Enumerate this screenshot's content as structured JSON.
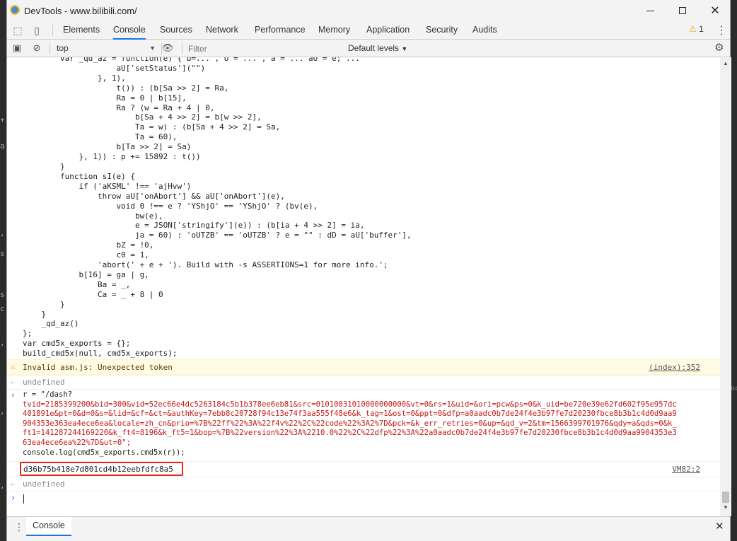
{
  "window": {
    "title": "DevTools - www.bilibili.com/"
  },
  "tabs": [
    {
      "label": "Elements"
    },
    {
      "label": "Console"
    },
    {
      "label": "Sources"
    },
    {
      "label": "Network"
    },
    {
      "label": "Performance"
    },
    {
      "label": "Memory"
    },
    {
      "label": "Application"
    },
    {
      "label": "Security"
    },
    {
      "label": "Audits"
    }
  ],
  "active_tab": "Console",
  "warning_count": "1",
  "toolbar": {
    "context": "top",
    "filter_placeholder": "Filter",
    "levels": "Default levels"
  },
  "console": {
    "code_lines": "        var _qd_az = function(e) { b=... , U = ... , a = ... aU = e; ...\n                    aU['setStatus'](\"\")\n                }, 1),\n                    t()) : (b[Sa >> 2] = Ra,\n                    Ra = 0 | b[15],\n                    Ra ? (w = Ra + 4 | 0,\n                        b[Sa + 4 >> 2] = b[w >> 2],\n                        Ta = w) : (b[Sa + 4 >> 2] = Sa,\n                        Ta = 60),\n                    b[Ta >> 2] = Sa)\n            }, 1)) : p += 15892 : t())\n        }\n        function sI(e) {\n            if ('aKSML' !== 'ajHvw')\n                throw aU['onAbort'] && aU['onAbort'](e),\n                    void 0 !== e ? 'YShjO' == 'YShjO' ? (bv(e),\n                        bw(e),\n                        e = JSON['stringify'](e)) : (b[ia + 4 >> 2] = ia,\n                        ja = 60) : 'oUTZB' == 'oUTZB' ? e = \"\" : dD = aU['buffer'],\n                    bZ = !0,\n                    c0 = 1,\n                'abort(' + e + '). Build with -s ASSERTIONS=1 for more info.';\n            b[16] = ga | g,\n                Ba = _,\n                Ca = _ + 8 | 0\n        }\n    }\n    _qd_az()\n};\nvar cmd5x_exports = {};\nbuild_cmd5x(null, cmd5x_exports);",
    "warning_text": "Invalid asm.js: Unexpected token",
    "warning_source": "(index):352",
    "undefined_1": "undefined",
    "input_line1": "r = \"/dash?",
    "input_url": "tvid=2185399200&bid=300&vid=52ec66e4dc5263184c5b1b378ee6eb81&src=01010031010000000000&vt=0&rs=1&uid=&ori=pcw&ps=0&k_uid=be720e39e62fd602f95e957dc\n401891e&pt=0&d=0&s=&lid=&cf=&ct=&authKey=7ebb8c20728f94c13e74f3aa555f48e6&k_tag=1&ost=0&ppt=0&dfp=a0aadc0b7de24f4e3b97fe7d20230fbce8b3b1c4d0d9aa9\n904353e363ea4ece6ea&locale=zh_cn&prio=%7B%22ff%22%3A%22f4v%22%2C%22code%22%3A2%7D&pck=&k_err_retries=0&up=&qd_v=2&tm=1566399701976&qdy=a&qds=0&k_\nft1=141287244169220&k_ft4=8196&k_ft5=1&bop=%7B%22version%22%3A%2210.0%22%2C%22dfp%22%3A%22a0aadc0b7de24f4e3b97fe7d20230fbce8b3b1c4d0d9aa9904353e3\n63ea4ece6ea%22%7D&ut=0\";",
    "input_last": "console.log(cmd5x_exports.cmd5x(r));",
    "output_value": "d36b75b418e7d801cd4b12eebfdfc8a5",
    "output_source": "VM82:2",
    "undefined_2": "undefined"
  },
  "drawer": {
    "tab": "Console"
  },
  "colors": {
    "accent": "#1a73e8",
    "string": "#c41a16",
    "highlight_box": "#e5271d",
    "warning_bg": "#fffbe5"
  }
}
